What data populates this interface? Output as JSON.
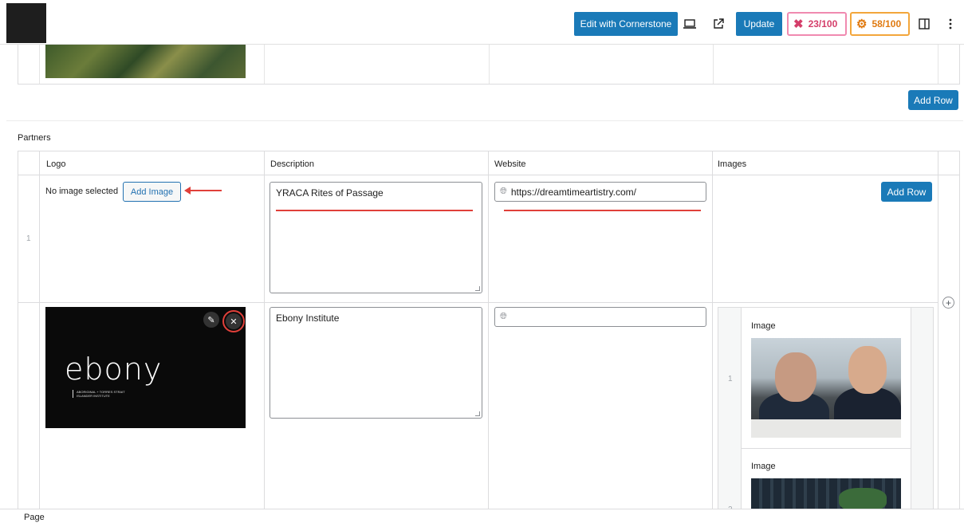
{
  "toolbar": {
    "edit_cornerstone_label": "Edit with Cornerstone",
    "update_label": "Update",
    "seo_score": "23/100",
    "readability_score": "58/100",
    "view_icon": "laptop-icon",
    "preview_icon": "external-link-icon",
    "settings_icon": "sidebar-toggle-icon",
    "options_icon": "more-vertical-icon"
  },
  "upper_repeater": {
    "add_row_label": "Add Row"
  },
  "partners": {
    "section_label": "Partners",
    "columns": [
      "Logo",
      "Description",
      "Website",
      "Images"
    ],
    "rows": [
      {
        "number": "1",
        "logo_status": "No image selected",
        "add_image_label": "Add Image",
        "description": "YRACA Rites of Passage",
        "website": "https://dreamtimeartistry.com/",
        "add_row_label": "Add Row"
      },
      {
        "number": "",
        "logo_word": "ebony",
        "logo_subtitle": "ABORIGINAL + TORRES STRAIT ISLANDER INSTITUTE",
        "description": "Ebony Institute",
        "website": "",
        "images": [
          {
            "number": "1",
            "label": "Image"
          },
          {
            "number": "2",
            "label": "Image"
          }
        ]
      }
    ]
  },
  "footer": {
    "label": "Page"
  },
  "annotation_color": "#e0403a"
}
